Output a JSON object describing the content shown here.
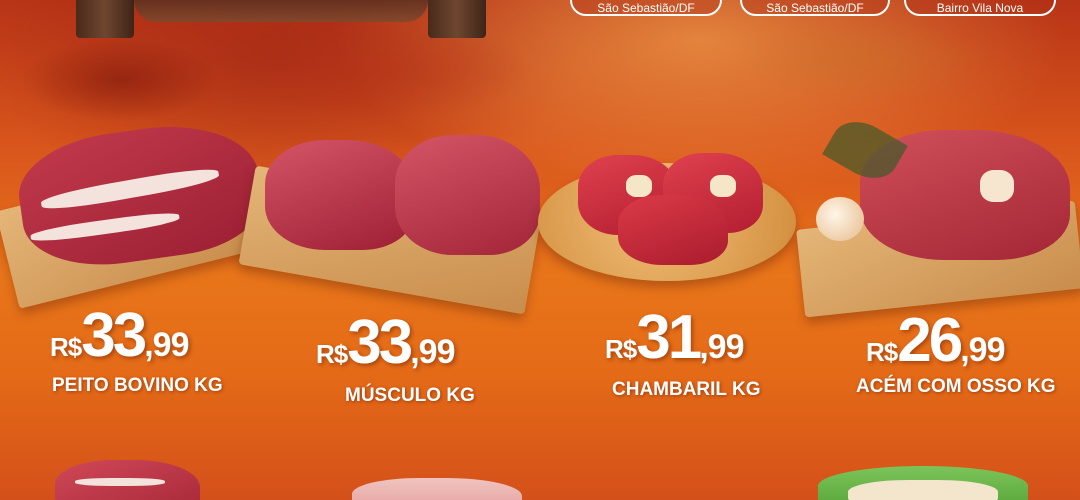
{
  "header": {
    "stores": [
      {
        "location": "São Sebastião/DF"
      },
      {
        "location": "São Sebastião/DF"
      },
      {
        "location": "Bairro Vila Nova"
      }
    ]
  },
  "products": [
    {
      "name": "PEITO BOVINO KG",
      "currency": "R$",
      "price_int": "33",
      "price_cents": ",99",
      "image": "brisket-on-board-image"
    },
    {
      "name": "MÚSCULO KG",
      "currency": "R$",
      "price_int": "33",
      "price_cents": ",99",
      "image": "beef-shank-on-board-image"
    },
    {
      "name": "CHAMBARIL KG",
      "currency": "R$",
      "price_int": "31",
      "price_cents": ",99",
      "image": "osso-buco-on-plate-image"
    },
    {
      "name": "ACÉM COM OSSO KG",
      "currency": "R$",
      "price_int": "26",
      "price_cents": ",99",
      "image": "chuck-with-bone-on-board-image"
    }
  ],
  "colors": {
    "background_top": "#b83417",
    "background_bottom": "#e8751a",
    "text": "#ffffff",
    "meat_red": "#b8283a"
  }
}
